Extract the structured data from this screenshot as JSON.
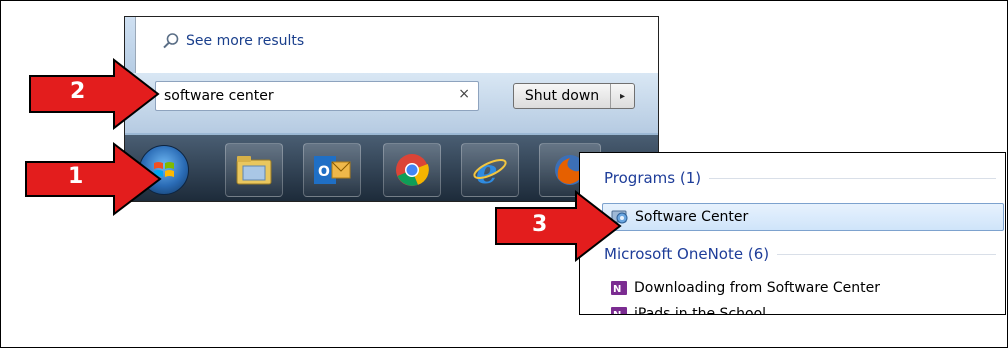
{
  "start_menu": {
    "see_more_label": "See more results",
    "search_value": "software center",
    "clear_glyph": "×",
    "shutdown_label": "Shut down",
    "shutdown_arrow_glyph": "▸"
  },
  "taskbar": {
    "items": [
      "start-orb",
      "file-explorer",
      "outlook",
      "chrome",
      "internet-explorer",
      "firefox"
    ]
  },
  "results_popup": {
    "programs_header": "Programs (1)",
    "program_item": "Software Center",
    "onenote_header": "Microsoft OneNote (6)",
    "onenote_item_1": "Downloading from Software Center",
    "onenote_item_2": "iPads in the School"
  },
  "callouts": {
    "step1": "1",
    "step2": "2",
    "step3": "3"
  },
  "colors": {
    "callout_red": "#e31d1d",
    "link_blue": "#1e3d99",
    "selection_border": "#7da2ce"
  }
}
